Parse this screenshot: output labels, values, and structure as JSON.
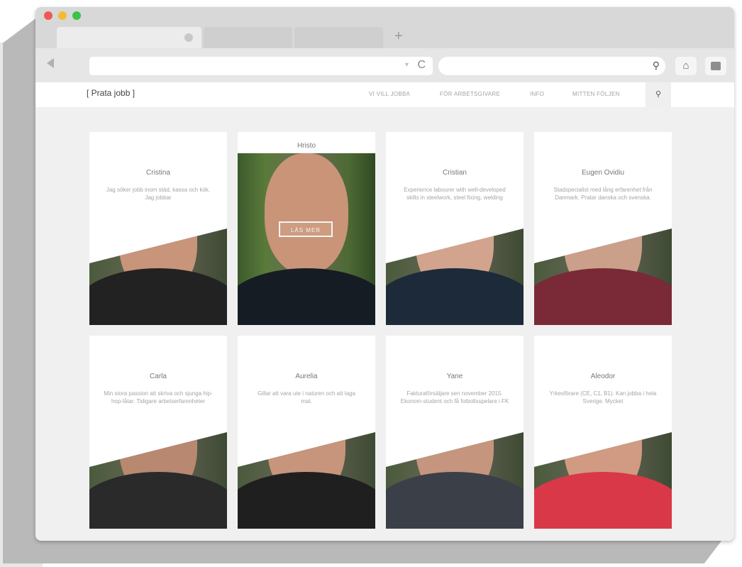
{
  "browser": {
    "new_tab_label": "+",
    "reload_glyph": "C",
    "url_dropdown_glyph": "▾",
    "search_glyph": "⚲",
    "home_glyph": "⌂"
  },
  "site": {
    "brand": "[ Prata jobb ]",
    "nav": [
      {
        "label": "VI VILL JOBBA"
      },
      {
        "label": "FÖR ARBETSGIVARE"
      },
      {
        "label": "INFO"
      },
      {
        "label": "MITTEN FÖLJEN"
      }
    ],
    "search_glyph": "⚲"
  },
  "cards": [
    {
      "name": "Cristina",
      "desc": "Jag söker jobb inom städ, kassa och kök. Jag jobbar",
      "hover": false,
      "skin": "#c8947a",
      "shirt": "#222222"
    },
    {
      "name": "Hristo",
      "desc": "",
      "hover": true,
      "skin": "#c99477",
      "shirt": "#151c24",
      "button": "LÄS MER"
    },
    {
      "name": "Cristian",
      "desc": "Experience labourer with well-developed skills in steelwork, steel fixing, welding",
      "hover": false,
      "skin": "#d2a48d",
      "shirt": "#1d2a3a"
    },
    {
      "name": "Eugen Ovidiu",
      "desc": "Stadspecialist med lång erfarenhet från Danmark. Pratar danska och svenska.",
      "hover": false,
      "skin": "#caa08b",
      "shirt": "#7a2a36"
    },
    {
      "name": "Carla",
      "desc": "Min stora passion att skriva och sjunga hip-hop-låtar. Tidigare arbetserfarenheter",
      "hover": false,
      "skin": "#b88870",
      "shirt": "#2a2a2a"
    },
    {
      "name": "Aurelia",
      "desc": "Gillar att vara ute i naturen och att laga mat.",
      "hover": false,
      "skin": "#c6957c",
      "shirt": "#1f1f1f"
    },
    {
      "name": "Yane",
      "desc": "Fakturaförsäljare sen november 2015. Ekonom-student och få fotbollsspelare i FK",
      "hover": false,
      "skin": "#c5957e",
      "shirt": "#3a3f48"
    },
    {
      "name": "Aleodor",
      "desc": "Yrkesförare (CE, C1, B1). Kan jobba i hela Sverige. Mycket",
      "hover": false,
      "skin": "#d09b82",
      "shirt": "#d93848"
    }
  ]
}
